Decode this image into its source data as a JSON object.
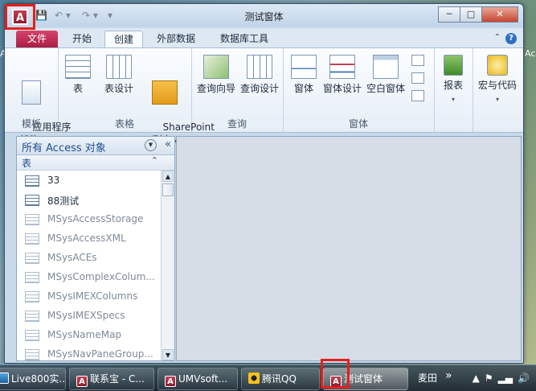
{
  "desktop": {
    "left_text": "Ac",
    "right_text": "Ac"
  },
  "window": {
    "title": "测试窗体",
    "controls": {
      "minimize": "─",
      "maximize": "□",
      "close": "✕"
    }
  },
  "qat": {
    "save": "💾",
    "undo": "↶ ▾",
    "redo": "↷ ▾",
    "customize": "▾"
  },
  "tabs": {
    "file": "文件",
    "items": [
      {
        "label": "开始"
      },
      {
        "label": "创建"
      },
      {
        "label": "外部数据"
      },
      {
        "label": "数据库工具"
      }
    ],
    "help": "?"
  },
  "ribbon": {
    "groups": {
      "templates": "模板",
      "tables": "表格",
      "queries": "查询",
      "forms": "窗体",
      "reports": "",
      "macros": ""
    },
    "buttons": {
      "app_parts": "应用程序\n部件",
      "table": "表",
      "table_design": "表设计",
      "sharepoint": "SharePoint\n列表",
      "query_wizard": "查询向导",
      "query_design": "查询设计",
      "form": "窗体",
      "form_design": "窗体设计",
      "blank_form": "空白窗体",
      "report": "报表",
      "macro_code": "宏与代码"
    }
  },
  "nav": {
    "title": "所有 Access 对象",
    "section": "表",
    "items": [
      {
        "label": "33",
        "system": false
      },
      {
        "label": "88测试",
        "system": false
      },
      {
        "label": "MSysAccessStorage",
        "system": true
      },
      {
        "label": "MSysAccessXML",
        "system": true
      },
      {
        "label": "MSysACEs",
        "system": true
      },
      {
        "label": "MSysComplexColum...",
        "system": true
      },
      {
        "label": "MSysIMEXColumns",
        "system": true
      },
      {
        "label": "MSysIMEXSpecs",
        "system": true
      },
      {
        "label": "MSysNameMap",
        "system": true
      },
      {
        "label": "MSysNavPaneGroup...",
        "system": true
      }
    ]
  },
  "taskbar": {
    "items": [
      {
        "label": "Live800实..."
      },
      {
        "label": "联系宝 - C..."
      },
      {
        "label": "UMVsoft..."
      },
      {
        "label": "腾讯QQ"
      },
      {
        "label": "测试窗体"
      },
      {
        "label": "麦田"
      }
    ],
    "overflow": "»"
  }
}
